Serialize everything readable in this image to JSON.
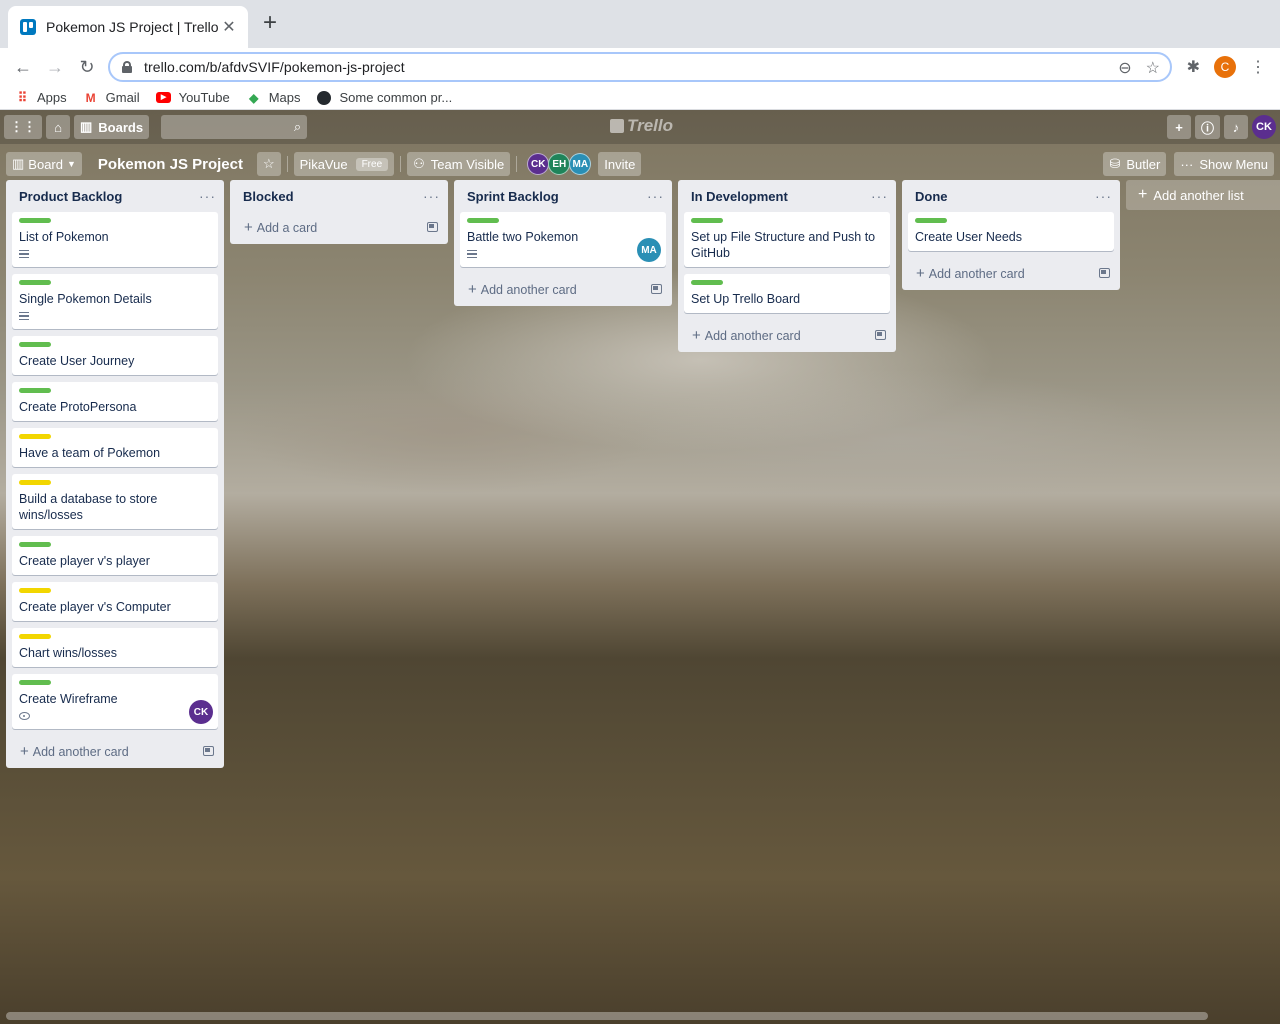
{
  "browser": {
    "tab_title": "Pokemon JS Project | Trello",
    "url": "trello.com/b/afdvSVIF/pokemon-js-project",
    "profile_initial": "C",
    "bookmarks": [
      "Apps",
      "Gmail",
      "YouTube",
      "Maps",
      "Some common pr..."
    ]
  },
  "trello": {
    "nav_boards_label": "Boards",
    "logo_text": "Trello",
    "user_initials": "CK",
    "board": {
      "view_label": "Board",
      "title": "Pokemon JS Project",
      "team_name": "PikaVue",
      "team_plan": "Free",
      "visibility": "Team Visible",
      "members": [
        {
          "initials": "CK",
          "color": "#5b2e8f"
        },
        {
          "initials": "EH",
          "color": "#1f845a"
        },
        {
          "initials": "MA",
          "color": "#2a8fb5"
        }
      ],
      "invite_label": "Invite",
      "butler_label": "Butler",
      "show_menu_label": "Show Menu"
    },
    "lists": [
      {
        "title": "Product Backlog",
        "add_label": "Add another card",
        "cards": [
          {
            "text": "List of Pokemon",
            "label_color": "#61bd4f",
            "badge": "description"
          },
          {
            "text": "Single Pokemon Details",
            "label_color": "#61bd4f",
            "badge": "description"
          },
          {
            "text": "Create User Journey",
            "label_color": "#61bd4f"
          },
          {
            "text": "Create ProtoPersona",
            "label_color": "#61bd4f"
          },
          {
            "text": "Have a team of Pokemon",
            "label_color": "#f2d600"
          },
          {
            "text": "Build a database to store wins/losses",
            "label_color": "#f2d600"
          },
          {
            "text": "Create player v's player",
            "label_color": "#61bd4f"
          },
          {
            "text": "Create player v's Computer",
            "label_color": "#f2d600"
          },
          {
            "text": "Chart wins/losses",
            "label_color": "#f2d600"
          },
          {
            "text": "Create Wireframe",
            "label_color": "#61bd4f",
            "badge": "watch",
            "member": "CK",
            "member_color": "#5b2e8f"
          }
        ]
      },
      {
        "title": "Blocked",
        "add_label": "Add a card",
        "cards": []
      },
      {
        "title": "Sprint Backlog",
        "add_label": "Add another card",
        "cards": [
          {
            "text": "Battle two Pokemon",
            "label_color": "#61bd4f",
            "badge": "description",
            "member": "MA",
            "member_color": "#2a8fb5"
          }
        ]
      },
      {
        "title": "In Development",
        "add_label": "Add another card",
        "cards": [
          {
            "text": "Set up File Structure and Push to GitHub",
            "label_color": "#61bd4f"
          },
          {
            "text": "Set Up Trello Board",
            "label_color": "#61bd4f"
          }
        ]
      },
      {
        "title": "Done",
        "add_label": "Add another card",
        "cards": [
          {
            "text": "Create User Needs",
            "label_color": "#61bd4f"
          }
        ]
      }
    ],
    "add_list_label": "Add another list"
  }
}
